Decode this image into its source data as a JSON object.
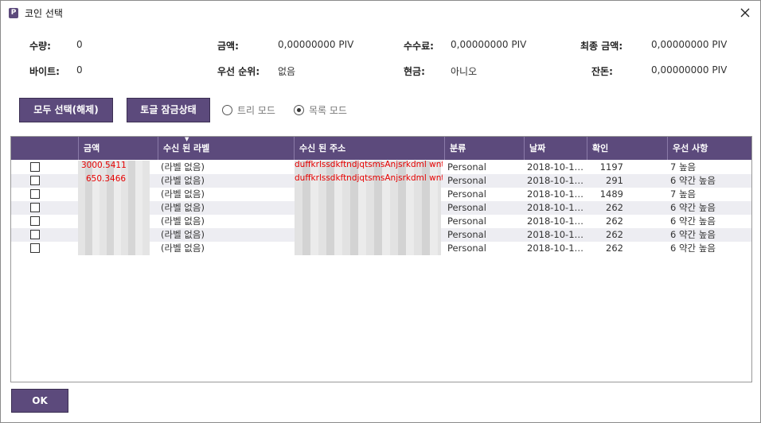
{
  "window": {
    "title": "코인 선택",
    "app_icon": "P"
  },
  "summary": {
    "quantity_label": "수량:",
    "quantity_value": "0",
    "amount_label": "금액:",
    "amount_value": "0,00000000 PIV",
    "fee_label": "수수료:",
    "fee_value": "0,00000000 PIV",
    "final_label": "최종 금액:",
    "final_value": "0,00000000 PIV",
    "bytes_label": "바이트:",
    "bytes_value": "0",
    "priority_label": "우선 순위:",
    "priority_value": "없음",
    "cash_label": "현금:",
    "cash_value": "아니오",
    "change_label": "잔돈:",
    "change_value": "0,00000000 PIV"
  },
  "controls": {
    "select_all": "모두 선택(해제)",
    "toggle_lock": "토글 잠금상태",
    "tree_mode": "트리 모드",
    "list_mode": "목록 모드",
    "selected_mode": "list"
  },
  "table": {
    "headers": [
      "금액",
      "수신 된 라벨",
      "수신 된 주소",
      "분류",
      "날짜",
      "확인",
      "우선 사항"
    ],
    "sort_indicator": "▼",
    "rows": [
      {
        "amount": "3000.5411",
        "label": "(라벨 없음)",
        "address": "duffkrlssdkftndjqtsmsAnjsrkdml wnth",
        "type": "Personal",
        "date": "2018-10-1…",
        "confirmations": "1197",
        "priority": "7 높음"
      },
      {
        "amount": "650.3466",
        "label": "(라벨 없음)",
        "address": "duffkrlssdkftndjqtsmsAnjsrkdml wnth",
        "type": "Personal",
        "date": "2018-10-1…",
        "confirmations": "291",
        "priority": "6 약간 높음"
      },
      {
        "amount": "",
        "label": "(라벨 없음)",
        "address": "",
        "type": "Personal",
        "date": "2018-10-1…",
        "confirmations": "1489",
        "priority": "7 높음"
      },
      {
        "amount": "",
        "label": "(라벨 없음)",
        "address": "",
        "type": "Personal",
        "date": "2018-10-1…",
        "confirmations": "262",
        "priority": "6 약간 높음"
      },
      {
        "amount": "",
        "label": "(라벨 없음)",
        "address": "",
        "type": "Personal",
        "date": "2018-10-1…",
        "confirmations": "262",
        "priority": "6 약간 높음"
      },
      {
        "amount": "",
        "label": "(라벨 없음)",
        "address": "",
        "type": "Personal",
        "date": "2018-10-1…",
        "confirmations": "262",
        "priority": "6 약간 높음"
      },
      {
        "amount": "",
        "label": "(라벨 없음)",
        "address": "",
        "type": "Personal",
        "date": "2018-10-1…",
        "confirmations": "262",
        "priority": "6 약간 높음"
      }
    ]
  },
  "footer": {
    "ok_label": "OK"
  },
  "colors": {
    "accent": "#5c4a7c",
    "highlight": "#e60000",
    "row_alt": "#ededf2"
  }
}
